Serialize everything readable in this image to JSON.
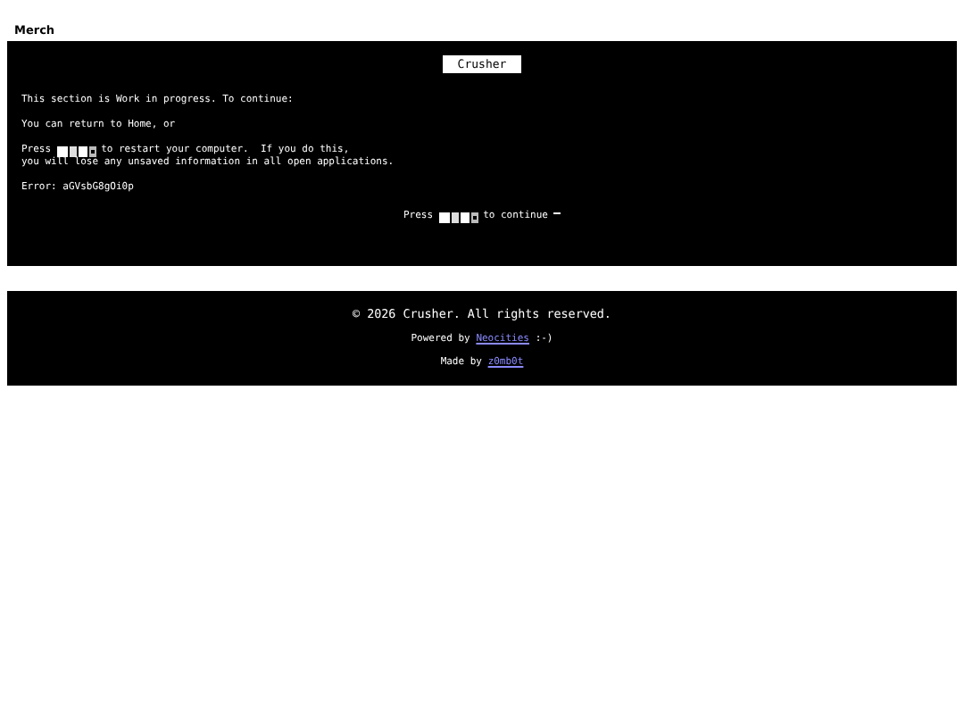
{
  "heading": "Merch",
  "panel": {
    "title": "Crusher",
    "lines": [
      {
        "kind": "text",
        "text": "This section is Work in progress. To continue:"
      },
      {
        "kind": "text",
        "text": "You can return to Home, or"
      },
      {
        "kind": "key",
        "before": "Press",
        "after": "to restart your computer.  If you do this,",
        "next": "you will lose any unsaved information in all open applications."
      },
      {
        "kind": "text",
        "text": "Error: aGVsbG8gOi0p"
      }
    ],
    "prompt": {
      "before": "Press",
      "after": "to continue"
    }
  },
  "footer": {
    "copyright": "© 2026 Crusher. All rights reserved.",
    "powered": {
      "before": "Powered by",
      "link": "Neocities",
      "after": ":-)"
    },
    "made": {
      "before": "Made by",
      "link": "z0mb0t"
    }
  }
}
